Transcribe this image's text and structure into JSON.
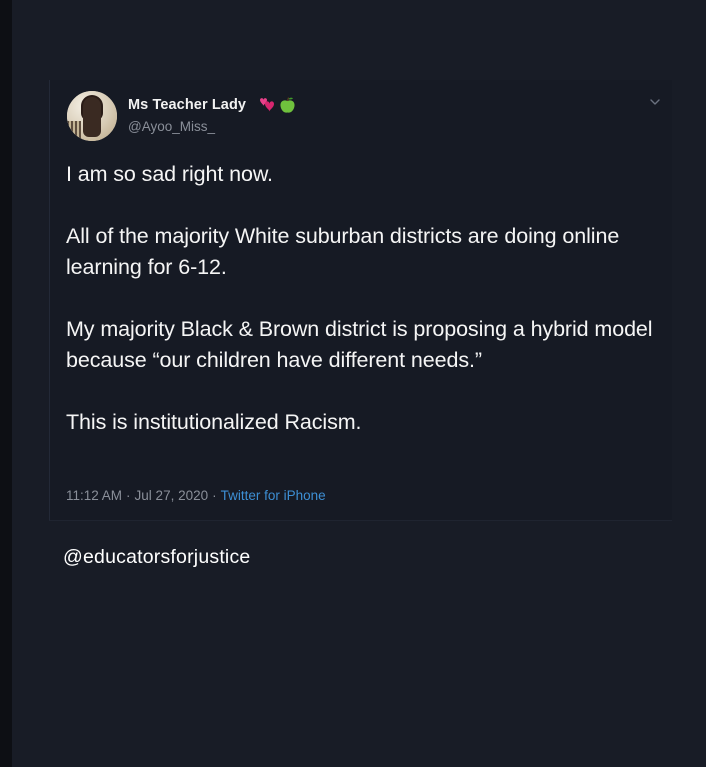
{
  "tweet": {
    "display_name": "Ms Teacher Lady",
    "handle": "@Ayoo_Miss_",
    "name_emojis": [
      "two-hearts-icon",
      "green-apple-icon"
    ],
    "paragraphs": [
      "I am so sad right now.",
      "All of the majority White suburban districts are doing online learning for 6-12.",
      "My majority Black & Brown district is proposing a hybrid model because “our children have different needs.”",
      "This is institutionalized Racism."
    ],
    "time": "11:12 AM",
    "separator": "·",
    "date": "Jul 27, 2020",
    "source": "Twitter for iPhone"
  },
  "footer": {
    "tag": "@educatorsforjustice"
  },
  "colors": {
    "background": "#181c26",
    "text": "#f5f5f5",
    "muted": "#8a8f99",
    "link": "#3d8fd4"
  }
}
